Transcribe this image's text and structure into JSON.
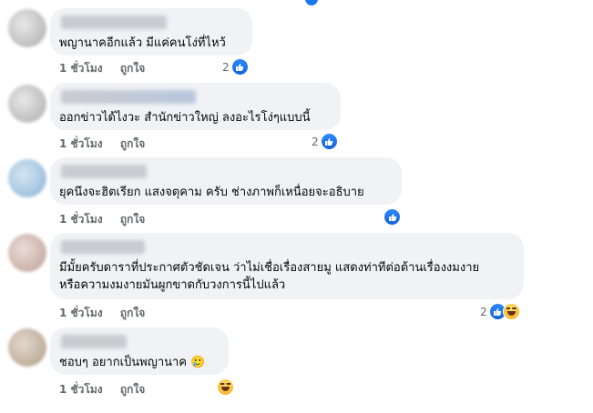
{
  "comments": [
    {
      "text_lines": [
        "พญานาคอีกแล้ว มีแค่คนโง่ที่ไหว้"
      ],
      "time": "1 ชั่วโมง",
      "like_label": "ถูกใจ",
      "reaction_count": "2",
      "reactions": [
        "like-icon"
      ]
    },
    {
      "text_lines": [
        "ออกข่าวได้ไงวะ สำนักข่าวใหญ่ ลงอะไรโง่ๆแบบนี้"
      ],
      "time": "1 ชั่วโมง",
      "like_label": "ถูกใจ",
      "reaction_count": "2",
      "reactions": [
        "like-icon"
      ]
    },
    {
      "text_lines": [
        "ยุคนึงจะฮิตเรียก แสงจตุคาม ครับ ช่างภาพก็เหนื่อยจะอธิบาย"
      ],
      "time": "1 ชั่วโมง",
      "like_label": "ถูกใจ",
      "reaction_count": "",
      "reactions": [
        "like-icon"
      ]
    },
    {
      "text_lines": [
        "มีมั้ยครับดาราที่ประกาศตัวชัดเจน ว่าไม่เชื่อเรื่องสายมู แสดงท่าทีต่อต้านเรื่องงมงาย",
        "หรือความงมงายมันผูกขาดกับวงการนี้ไปแล้ว"
      ],
      "time": "1 ชั่วโมง",
      "like_label": "ถูกใจ",
      "reaction_count": "2",
      "reactions": [
        "like-icon",
        "haha-icon"
      ]
    },
    {
      "text_lines": [
        "ชอบๆ อยากเป็นพญานาค 🥲"
      ],
      "time": "1 ชั่วโมง",
      "like_label": "ถูกใจ",
      "reaction_count": "",
      "reactions": [
        "haha-icon"
      ]
    }
  ]
}
